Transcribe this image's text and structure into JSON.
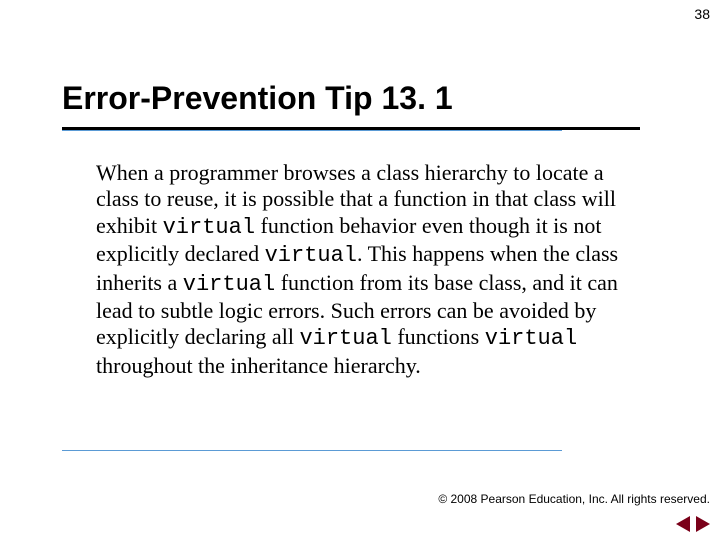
{
  "page_number": "38",
  "title": "Error-Prevention Tip 13. 1",
  "body": {
    "t1": "When a programmer browses a class hierarchy to locate a class to reuse, it is possible that a function in that class will exhibit ",
    "kw1": "virtual",
    "t2": " function behavior even though it is not explicitly declared ",
    "kw2": "virtual",
    "t3": ". This happens when the class inherits a ",
    "kw3": "virtual",
    "t4": " function from its base class, and it can lead to subtle logic errors. Such errors can be avoided by explicitly declaring all ",
    "kw4": "virtual",
    "t5": " functions ",
    "kw5": "virtual",
    "t6": " throughout the inheritance hierarchy."
  },
  "footer": "© 2008 Pearson Education, Inc.  All rights reserved."
}
